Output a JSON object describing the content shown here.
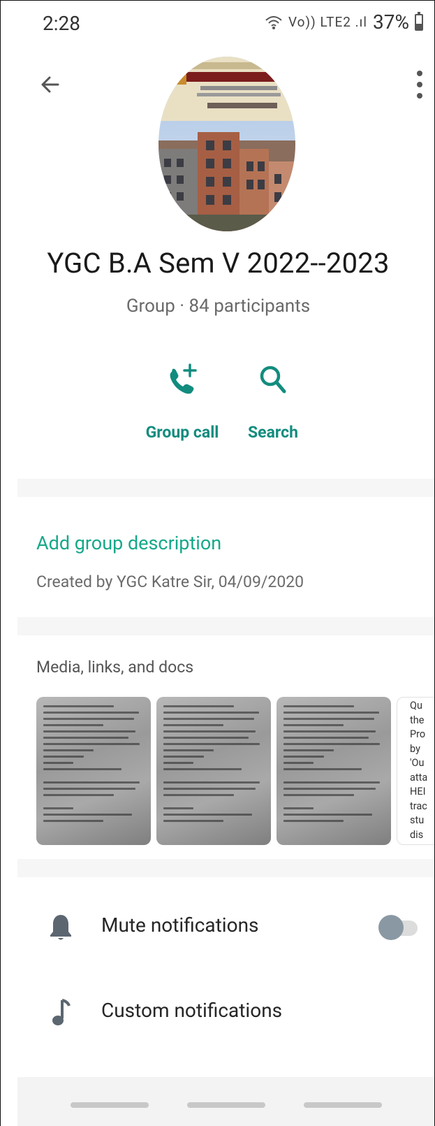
{
  "status_bar": {
    "time": "2:28",
    "network": "Vo)) LTE2 .ıl",
    "battery_percent": "37%"
  },
  "header": {
    "group_name": "YGC B.A Sem V 2022--2023",
    "subtitle": "Group · 84 participants",
    "actions": [
      {
        "label": "Group call",
        "icon": "group-call-icon"
      },
      {
        "label": "Search",
        "icon": "search-icon"
      }
    ]
  },
  "description": {
    "add_label": "Add group description",
    "created_by": "Created by YGC Katre Sir, 04/09/2020"
  },
  "media": {
    "title": "Media, links, and docs",
    "doc_preview": "Qu\nthe\nPro\nby\n'Ou\natta\nHEI\ntrac\nstu\ndis"
  },
  "settings": {
    "mute_label": "Mute notifications",
    "mute_enabled": false,
    "custom_label": "Custom notifications"
  },
  "colors": {
    "accent": "#128c7e",
    "link": "#15a889",
    "background": "#f6f6f6"
  }
}
